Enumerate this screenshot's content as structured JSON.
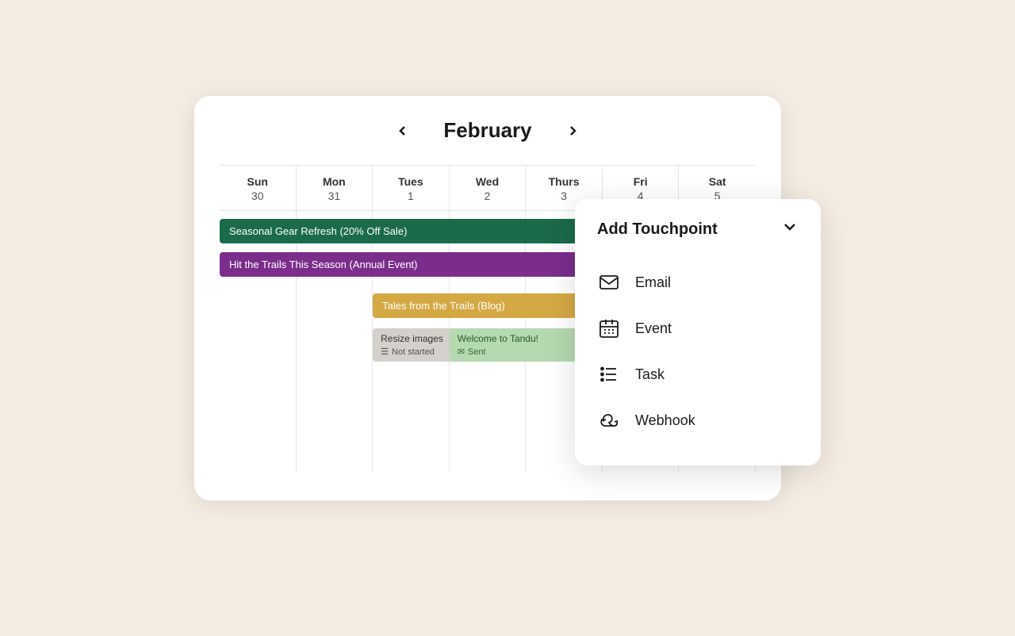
{
  "calendar": {
    "title": "February",
    "prev_label": "←",
    "next_label": "→",
    "days": [
      {
        "name": "Sun",
        "number": "30"
      },
      {
        "name": "Mon",
        "number": "31"
      },
      {
        "name": "Tues",
        "number": "1"
      },
      {
        "name": "Wed",
        "number": "2"
      },
      {
        "name": "Thurs",
        "number": "3"
      },
      {
        "name": "Fri",
        "number": "4"
      },
      {
        "name": "Sat",
        "number": "5"
      }
    ],
    "events": [
      {
        "id": "seasonal",
        "title": "Seasonal Gear Refresh (20% Off Sale)"
      },
      {
        "id": "trails",
        "title": "Hit the Trails This Season (Annual Event)"
      },
      {
        "id": "tales",
        "title": "Tales from the Trails (Blog)"
      },
      {
        "id": "resize",
        "title": "Resize images",
        "status": "Not started"
      },
      {
        "id": "welcome",
        "title": "Welcome to Tandu!",
        "status": "Sent"
      }
    ]
  },
  "dropdown": {
    "title": "Add Touchpoint",
    "chevron": "∨",
    "items": [
      {
        "id": "email",
        "label": "Email",
        "icon": "email-icon"
      },
      {
        "id": "event",
        "label": "Event",
        "icon": "event-icon"
      },
      {
        "id": "task",
        "label": "Task",
        "icon": "task-icon"
      },
      {
        "id": "webhook",
        "label": "Webhook",
        "icon": "webhook-icon"
      }
    ]
  }
}
